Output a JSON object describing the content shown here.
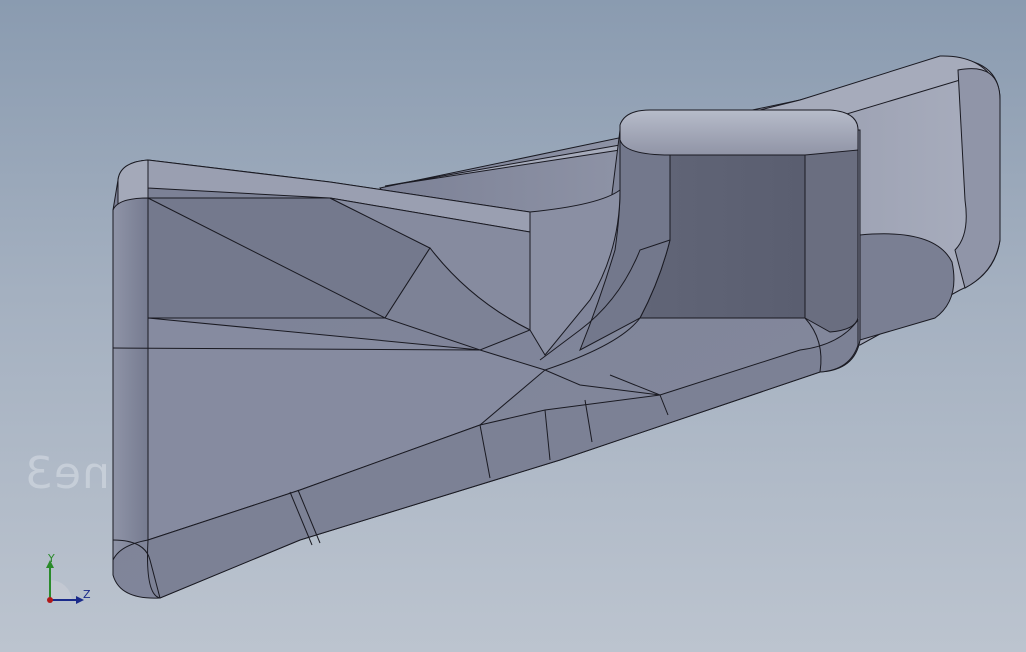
{
  "viewport": {
    "background_top": "#8a9bb0",
    "background_bottom": "#bcc4cf",
    "model_color": "#7f8396"
  },
  "watermark": {
    "text": "ane3"
  },
  "triad": {
    "y_label": "Y",
    "z_label": "Z",
    "y_color": "#2a8a2a",
    "z_color": "#1a2a8a",
    "origin_color": "#b01818"
  }
}
